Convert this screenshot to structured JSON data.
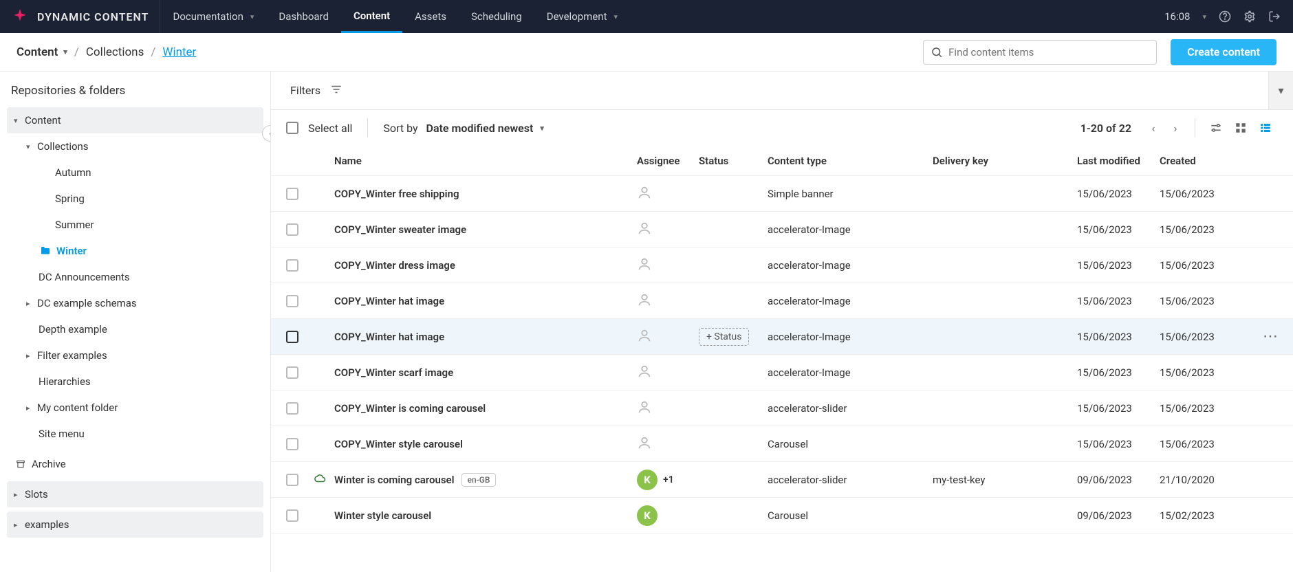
{
  "brand": "DYNAMIC CONTENT",
  "time": "16:08",
  "nav": {
    "documentation": "Documentation",
    "dashboard": "Dashboard",
    "content": "Content",
    "assets": "Assets",
    "scheduling": "Scheduling",
    "development": "Development"
  },
  "breadcrumb": {
    "root": "Content",
    "mid": "Collections",
    "current": "Winter"
  },
  "search": {
    "placeholder": "Find content items"
  },
  "create_btn": "Create content",
  "sidebar": {
    "title": "Repositories & folders",
    "content": "Content",
    "collections": "Collections",
    "autumn": "Autumn",
    "spring": "Spring",
    "summer": "Summer",
    "winter": "Winter",
    "dc_ann": "DC Announcements",
    "dc_schemas": "DC example schemas",
    "depth": "Depth example",
    "filter": "Filter examples",
    "hier": "Hierarchies",
    "my_folder": "My content folder",
    "site_menu": "Site menu",
    "archive": "Archive",
    "slots": "Slots",
    "examples": "examples"
  },
  "filter_bar": {
    "label": "Filters"
  },
  "toolbar": {
    "select_all": "Select all",
    "sort_by": "Sort by",
    "sort_value": "Date modified newest",
    "paging": "1-20 of 22"
  },
  "columns": {
    "name": "Name",
    "assignee": "Assignee",
    "status": "Status",
    "ctype": "Content type",
    "dkey": "Delivery key",
    "modified": "Last modified",
    "created": "Created"
  },
  "status_chip": "+ Status",
  "rows": [
    {
      "name": "COPY_Winter free shipping",
      "ctype": "Simple banner",
      "mod": "15/06/2023",
      "created": "15/06/2023",
      "assignee_type": "empty"
    },
    {
      "name": "COPY_Winter sweater image",
      "ctype": "accelerator-Image",
      "mod": "15/06/2023",
      "created": "15/06/2023",
      "assignee_type": "empty"
    },
    {
      "name": "COPY_Winter dress image",
      "ctype": "accelerator-Image",
      "mod": "15/06/2023",
      "created": "15/06/2023",
      "assignee_type": "empty"
    },
    {
      "name": "COPY_Winter hat image",
      "ctype": "accelerator-Image",
      "mod": "15/06/2023",
      "created": "15/06/2023",
      "assignee_type": "empty"
    },
    {
      "name": "COPY_Winter hat image",
      "ctype": "accelerator-Image",
      "mod": "15/06/2023",
      "created": "15/06/2023",
      "assignee_type": "empty",
      "hovered": true,
      "status_chip": true
    },
    {
      "name": "COPY_Winter scarf image",
      "ctype": "accelerator-Image",
      "mod": "15/06/2023",
      "created": "15/06/2023",
      "assignee_type": "empty"
    },
    {
      "name": "COPY_Winter is coming carousel",
      "ctype": "accelerator-slider",
      "mod": "15/06/2023",
      "created": "15/06/2023",
      "assignee_type": "empty"
    },
    {
      "name": "COPY_Winter style carousel",
      "ctype": "Carousel",
      "mod": "15/06/2023",
      "created": "15/06/2023",
      "assignee_type": "empty"
    },
    {
      "name": "Winter is coming carousel",
      "locale": "en-GB",
      "ctype": "accelerator-slider",
      "dkey": "my-test-key",
      "mod": "09/06/2023",
      "created": "21/10/2020",
      "assignee_type": "badge",
      "badge": "K",
      "plus": "+1",
      "cloud": true
    },
    {
      "name": "Winter style carousel",
      "ctype": "Carousel",
      "mod": "09/06/2023",
      "created": "15/02/2023",
      "assignee_type": "badge",
      "badge": "K"
    }
  ]
}
